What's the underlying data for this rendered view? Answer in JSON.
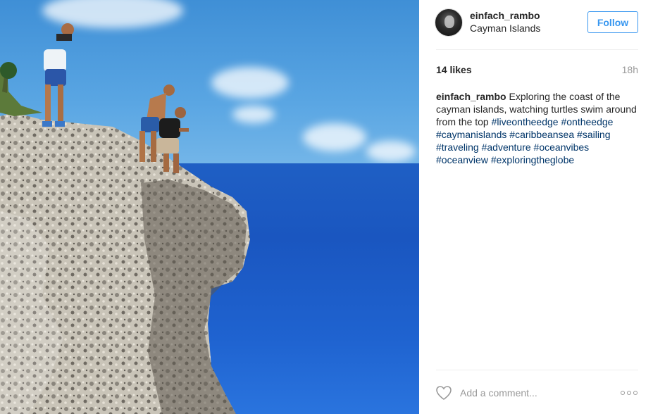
{
  "post": {
    "image_alt_icon": "post-photo",
    "author": {
      "username": "einfach_rambo",
      "location": "Cayman Islands"
    },
    "follow_label": "Follow",
    "likes": "14 likes",
    "time": "18h",
    "caption": {
      "username": "einfach_rambo",
      "text": "Exploring the coast of the cayman islands, watching turtles swim around from the top",
      "hashtags": [
        "#liveontheedge",
        "#ontheedge",
        "#caymanislands",
        "#caribbeansea",
        "#sailing",
        "#traveling",
        "#adventure",
        "#oceanvibes",
        "#oceanview",
        "#exploringtheglobe"
      ]
    },
    "comment_placeholder": "Add a comment...",
    "colors": {
      "accent": "#3897f0",
      "hashtag": "#003569",
      "muted": "#999999"
    }
  }
}
